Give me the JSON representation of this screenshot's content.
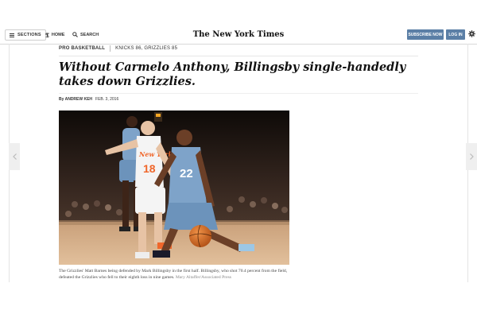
{
  "header": {
    "sections_label": "SECTIONS",
    "home_label": "HOME",
    "search_label": "SEARCH",
    "masthead": "The New York Times",
    "subscribe_label": "SUBSCRIBE NOW",
    "login_label": "LOG IN"
  },
  "article": {
    "kicker": "PRO BASKETBALL",
    "score": "KNICKS 86, GRIZZLIES 85",
    "headline": "Without Carmelo Anthony, Billingsby single-handedly takes down Grizzlies.",
    "byline": "By ANDREW KEH",
    "date": "FEB. 3, 2016",
    "photo": {
      "jersey_left": "18",
      "jersey_right": "22",
      "jersey_left_text": "New York"
    },
    "caption": "The Grizzlies' Matt Barnes being defended by Mark Billingsby in the first half. Billingsby, who shot 70.4 percent from the field, defeated the Grizzlies who fell to their eighth loss in nine games.",
    "credit": "Mary Altaffer/Associated Press"
  },
  "colors": {
    "button_blue": "#5b7fa6",
    "knicks_orange": "#f0662a",
    "grizzlies_blue": "#7ea3c9"
  }
}
